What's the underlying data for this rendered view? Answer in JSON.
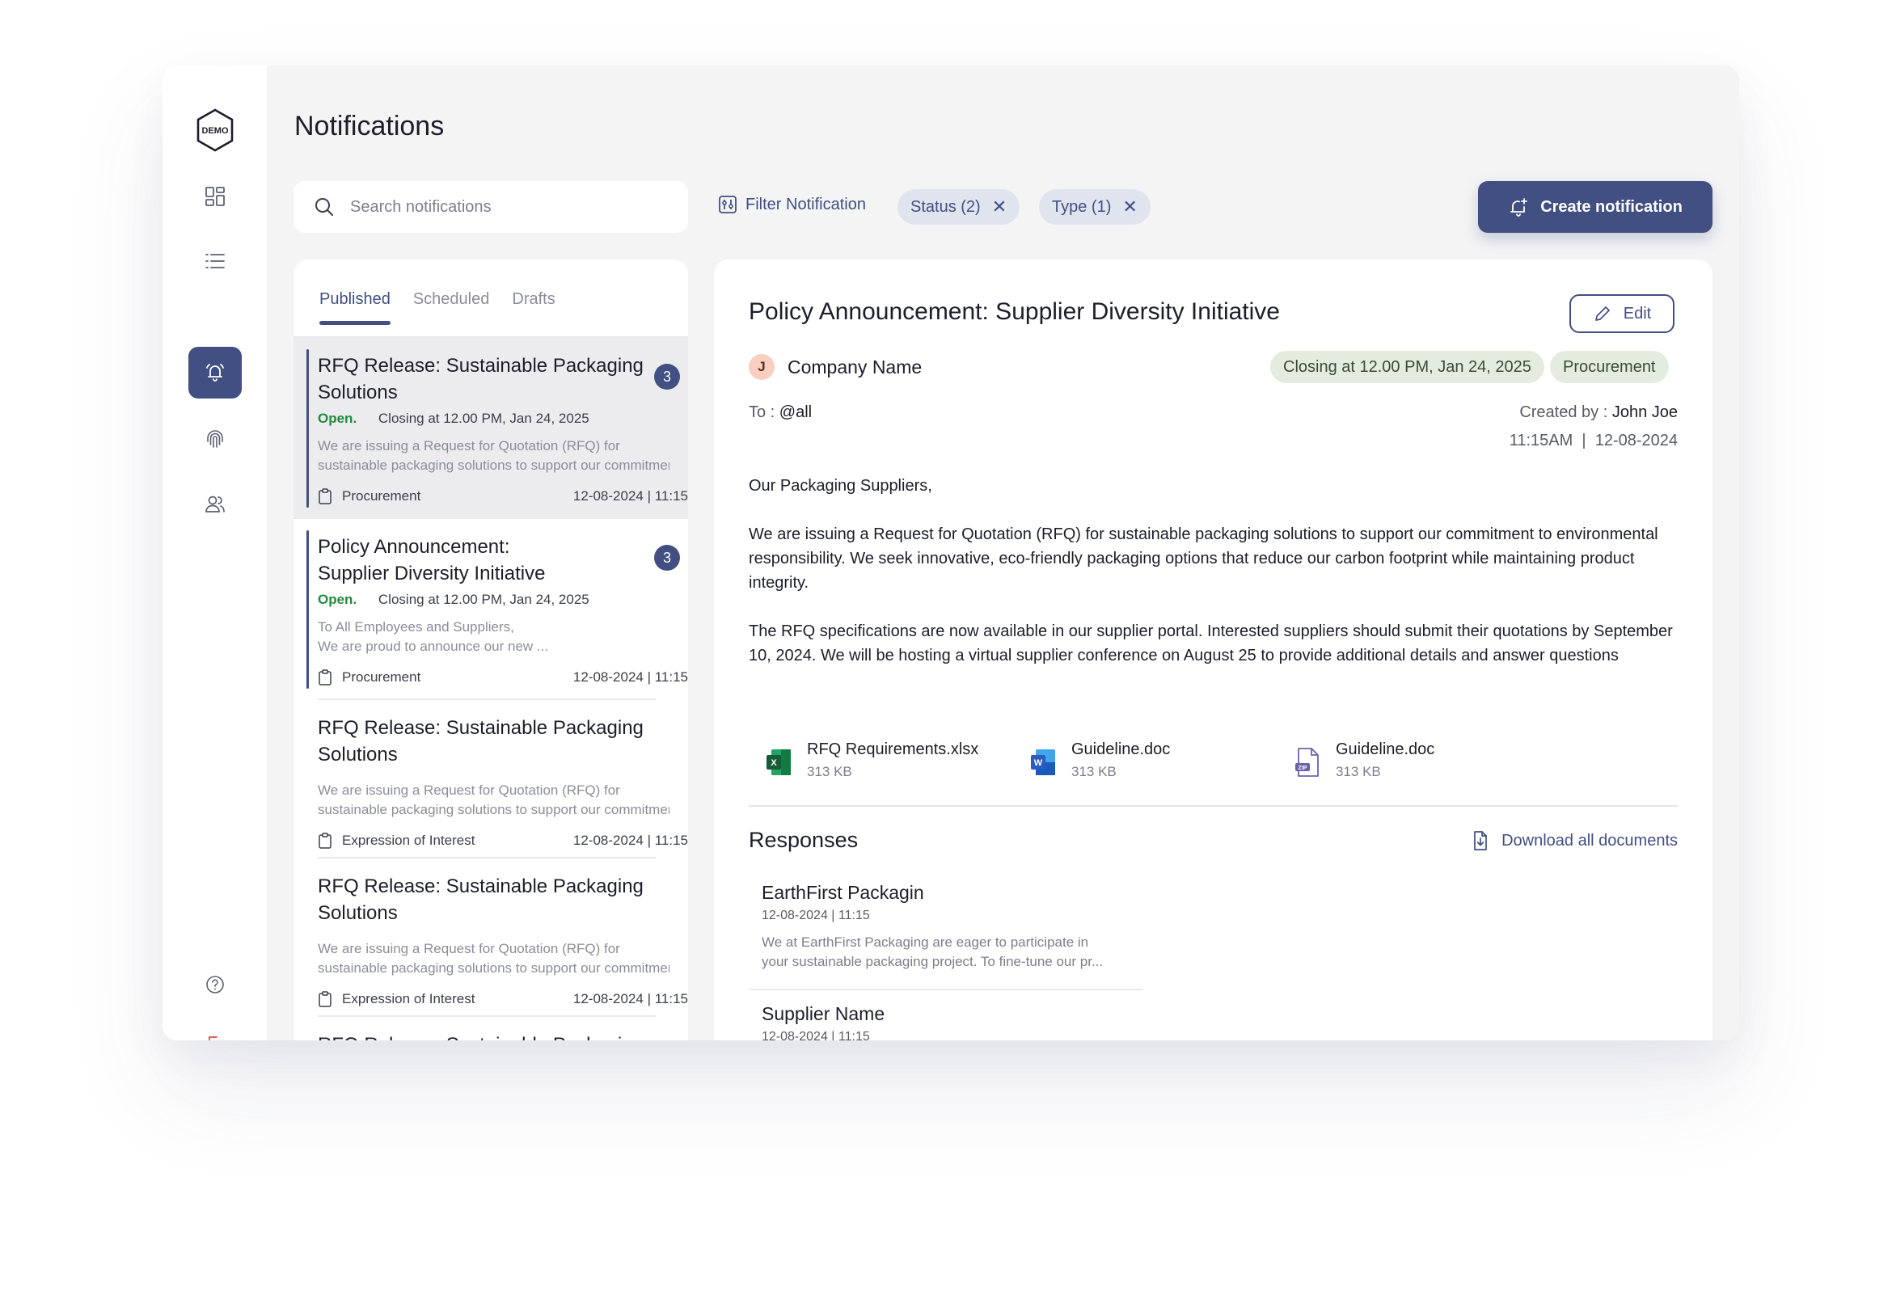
{
  "page_title": "Notifications",
  "search": {
    "placeholder": "Search notifications"
  },
  "filter": {
    "label": "Filter Notification"
  },
  "chips": [
    {
      "label": "Status (2)"
    },
    {
      "label": "Type (1)"
    }
  ],
  "create_button": {
    "label": "Create notification"
  },
  "logo": {
    "text": "DEMO"
  },
  "sidebar_icons": [
    "dashboard-icon",
    "list-icon",
    "bell-icon",
    "fingerprint-icon",
    "users-icon",
    "help-icon",
    "logout-icon"
  ],
  "tabs": [
    {
      "label": "Published",
      "active": true
    },
    {
      "label": "Scheduled",
      "active": false
    },
    {
      "label": "Drafts",
      "active": false
    }
  ],
  "list_items": [
    {
      "title": "RFQ Release: Sustainable Packaging Solutions",
      "status": "Open.",
      "closing": "Closing at 12.00 PM, Jan 24, 2025",
      "desc1": "We are issuing a Request for Quotation (RFQ) for",
      "desc2": "sustainable packaging solutions to support our commitment",
      "category": "Procurement",
      "date": "12-08-2024 | 11:15",
      "badge": "3"
    },
    {
      "title": "Policy Announcement: Supplier Diversity Initiative",
      "status": "Open.",
      "closing": "Closing at 12.00 PM, Jan 24, 2025",
      "desc1": "To All Employees and Suppliers,",
      "desc2": "We are proud to announce our new ...",
      "category": "Procurement",
      "date": "12-08-2024 | 11:15",
      "badge": "3"
    },
    {
      "title": "RFQ Release: Sustainable Packaging Solutions",
      "desc1": "We are issuing a Request for Quotation (RFQ) for",
      "desc2": "sustainable packaging solutions to support our commitment",
      "category": "Expression of Interest",
      "date": "12-08-2024 | 11:15"
    },
    {
      "title": "RFQ Release: Sustainable Packaging Solutions",
      "desc1": "We are issuing a Request for Quotation (RFQ) for",
      "desc2": "sustainable packaging solutions to support our commitment",
      "category": "Expression of Interest",
      "date": "12-08-2024 | 11:15"
    },
    {
      "title": "RFQ Release: Sustainable Packaging Solutions"
    }
  ],
  "detail": {
    "title": "Policy Announcement: Supplier Diversity Initiative",
    "edit_label": "Edit",
    "avatar_initial": "J",
    "company": "Company Name",
    "closing_tag": "Closing at 12.00 PM, Jan 24, 2025",
    "category_tag": "Procurement",
    "to_label": "To : ",
    "to_value": "@all",
    "created_label": "Created by : ",
    "created_by": "John Joe",
    "created_time": "11:15AM  |  12-08-2024",
    "greeting": "Our Packaging Suppliers,",
    "para1": "We are issuing a Request for Quotation (RFQ) for sustainable packaging solutions to support our commitment to environmental responsibility. We seek innovative, eco-friendly packaging options that reduce our carbon footprint while maintaining product integrity.",
    "para2": "The RFQ specifications are now available in our supplier portal. Interested suppliers should submit their quotations by September 10, 2024. We will be hosting a virtual supplier conference on August 25 to provide additional details and answer questions"
  },
  "attachments": [
    {
      "name": "RFQ Requirements.xlsx",
      "size": "313 KB",
      "icon": "excel-file-icon",
      "color": "#1f7a43"
    },
    {
      "name": "Guideline.doc",
      "size": "313 KB",
      "icon": "word-file-icon",
      "color": "#2b5cc0"
    },
    {
      "name": "Guideline.doc",
      "size": "313 KB",
      "icon": "zip-file-icon",
      "color": "#6a63a8"
    }
  ],
  "responses": {
    "heading": "Responses",
    "download_label": "Download all documents",
    "items": [
      {
        "name": "EarthFirst Packagin",
        "date": "12-08-2024 | 11:15",
        "text1": "We at EarthFirst Packaging are eager to participate in",
        "text2": "your sustainable packaging project. To fine-tune our pr..."
      },
      {
        "name": "Supplier Name",
        "date": "12-08-2024 | 11:15"
      }
    ]
  },
  "colors": {
    "primary": "#414f82",
    "open_status": "#1e8c3a",
    "tag_bg": "#e3ecde",
    "chip_bg": "#dfe4ee"
  }
}
